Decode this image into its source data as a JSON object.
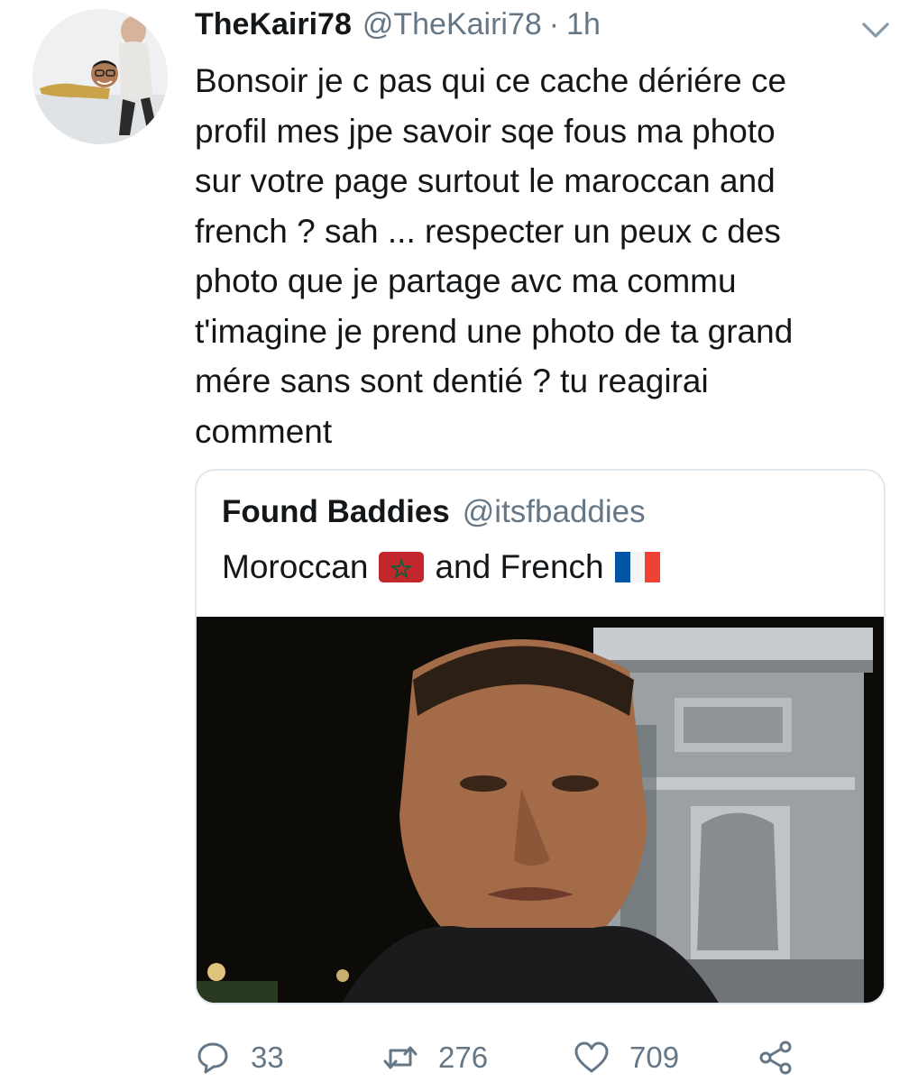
{
  "tweet": {
    "author_name": "TheKairi78",
    "author_handle": "@TheKairi78",
    "separator": "·",
    "time": "1h",
    "text": "Bonsoir je c pas qui ce cache dériére ce\nprofil mes jpe savoir sqe fous ma photo\nsur votre page surtout le maroccan and\nfrench ? sah ... respecter un peux c des\nphoto que je partage avc ma commu\nt'imagine je prend une photo de ta grand\nmére sans sont dentié ? tu reagirai\ncomment"
  },
  "quoted_tweet": {
    "author_name": "Found Baddies",
    "author_handle": "@itsfbaddies",
    "text_part1": "Moroccan",
    "text_part2": "and French",
    "flag_1_icon": "morocco-flag-emoji",
    "flag_2_icon": "france-flag-emoji"
  },
  "actions": {
    "reply_count": "33",
    "retweet_count": "276",
    "like_count": "709",
    "icons": [
      "reply-icon",
      "retweet-icon",
      "like-icon",
      "share-icon"
    ]
  },
  "colors": {
    "text": "#14171a",
    "secondary": "#657786",
    "border": "#e1e8ed"
  }
}
